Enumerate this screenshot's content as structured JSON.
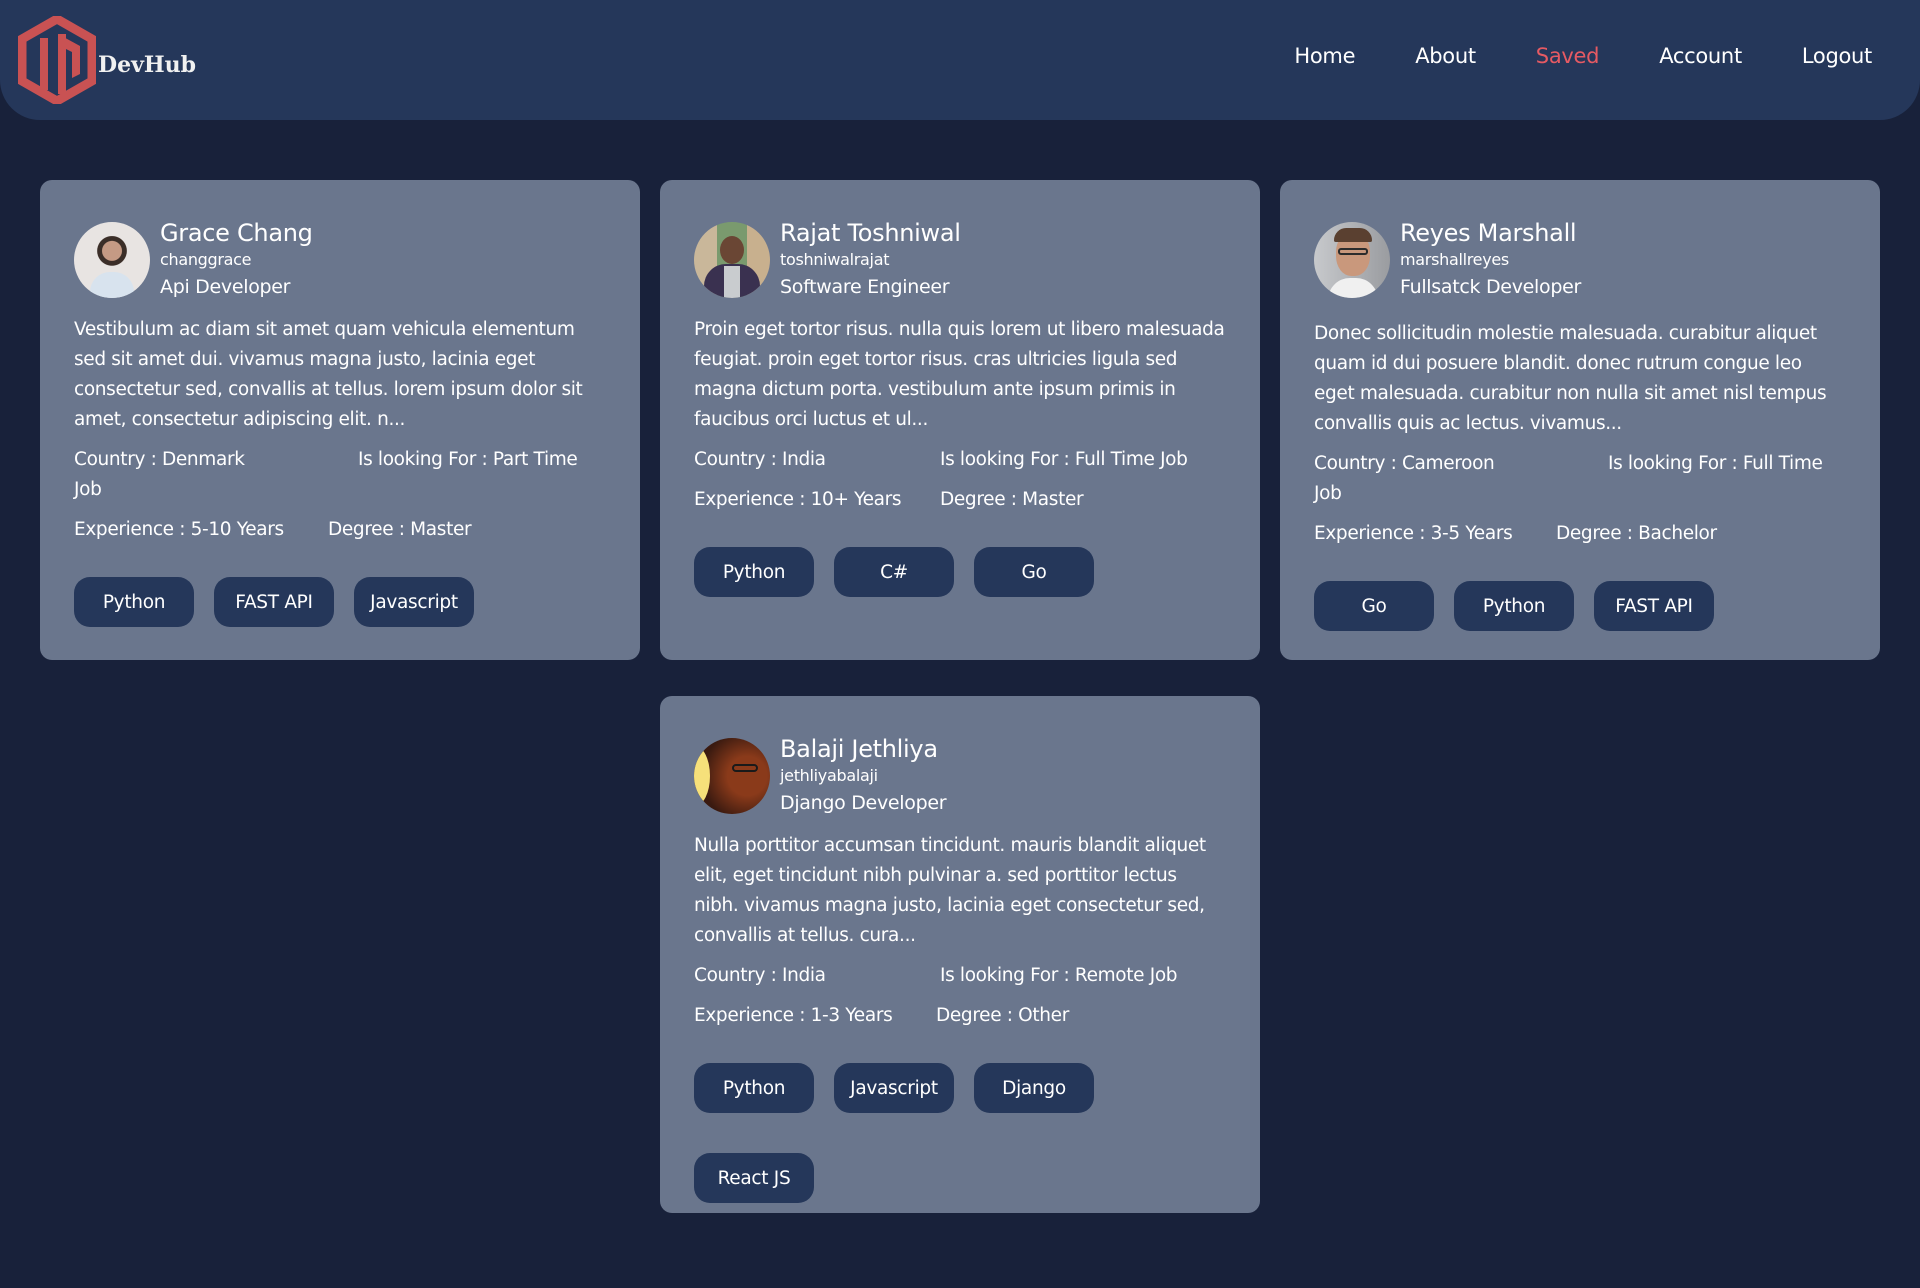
{
  "app": {
    "name": "DevHub",
    "accent_color": "#e65a63",
    "header_color": "#25375a",
    "card_color": "#6a768d",
    "background_color": "#18213a"
  },
  "nav": {
    "items": [
      {
        "label": "Home",
        "active": false
      },
      {
        "label": "About",
        "active": false
      },
      {
        "label": "Saved",
        "active": true
      },
      {
        "label": "Account",
        "active": false
      },
      {
        "label": "Logout",
        "active": false
      }
    ]
  },
  "profiles": [
    {
      "name": "Grace Chang",
      "username": "changgrace",
      "role": "Api Developer",
      "bio": "Vestibulum ac diam sit amet quam vehicula elementum sed sit amet dui. vivamus magna justo, lacinia eget consectetur sed, convallis at tellus. lorem ipsum dolor sit amet, consectetur adipiscing elit. n...",
      "country": "Country : Denmark",
      "looking_for": "Is looking For : Part Time Job",
      "experience": "Experience : 5-10 Years",
      "degree": "Degree : Master",
      "avatar": "avatar-photo-man-short-dark-hair",
      "tags": [
        "Python",
        "FAST API",
        "Javascript"
      ]
    },
    {
      "name": "Rajat Toshniwal",
      "username": "toshniwalrajat",
      "role": "Software Engineer",
      "bio": "Proin eget tortor risus. nulla quis lorem ut libero malesuada feugiat. proin eget tortor risus. cras ultricies ligula sed magna dictum porta. vestibulum ante ipsum primis in faucibus orci luctus et ul...",
      "country": "Country : India",
      "looking_for": "Is looking For : Full Time Job",
      "experience": "Experience : 10+ Years",
      "degree": "Degree : Master",
      "avatar": "avatar-photo-man-blazer-outdoor",
      "tags": [
        "Python",
        "C#",
        "Go"
      ]
    },
    {
      "name": "Reyes Marshall",
      "username": "marshallreyes",
      "role": "Fullsatck Developer",
      "bio": "Donec sollicitudin molestie malesuada. curabitur aliquet quam id dui posuere blandit. donec rutrum congue leo eget malesuada. curabitur non nulla sit amet nisl tempus convallis quis ac lectus. vivamus...",
      "country": "Country : Cameroon",
      "looking_for": "Is looking For : Full Time Job",
      "experience": "Experience : 3-5 Years",
      "degree": "Degree : Bachelor",
      "avatar": "avatar-photo-man-glasses-beard",
      "tags": [
        "Go",
        "Python",
        "FAST API"
      ]
    },
    {
      "name": "Balaji Jethliya",
      "username": "jethliyabalaji",
      "role": "Django Developer",
      "bio": "Nulla porttitor accumsan tincidunt. mauris blandit aliquet elit, eget tincidunt nibh pulvinar a. sed porttitor lectus nibh. vivamus magna justo, lacinia eget consectetur sed, convallis at tellus. cura...",
      "country": "Country : India",
      "looking_for": "Is looking For : Remote Job",
      "experience": "Experience : 1-3 Years",
      "degree": "Degree : Other",
      "avatar": "avatar-photo-man-glasses-dark-warm-light",
      "tags": [
        "Python",
        "Javascript",
        "Django",
        "React JS"
      ]
    }
  ]
}
